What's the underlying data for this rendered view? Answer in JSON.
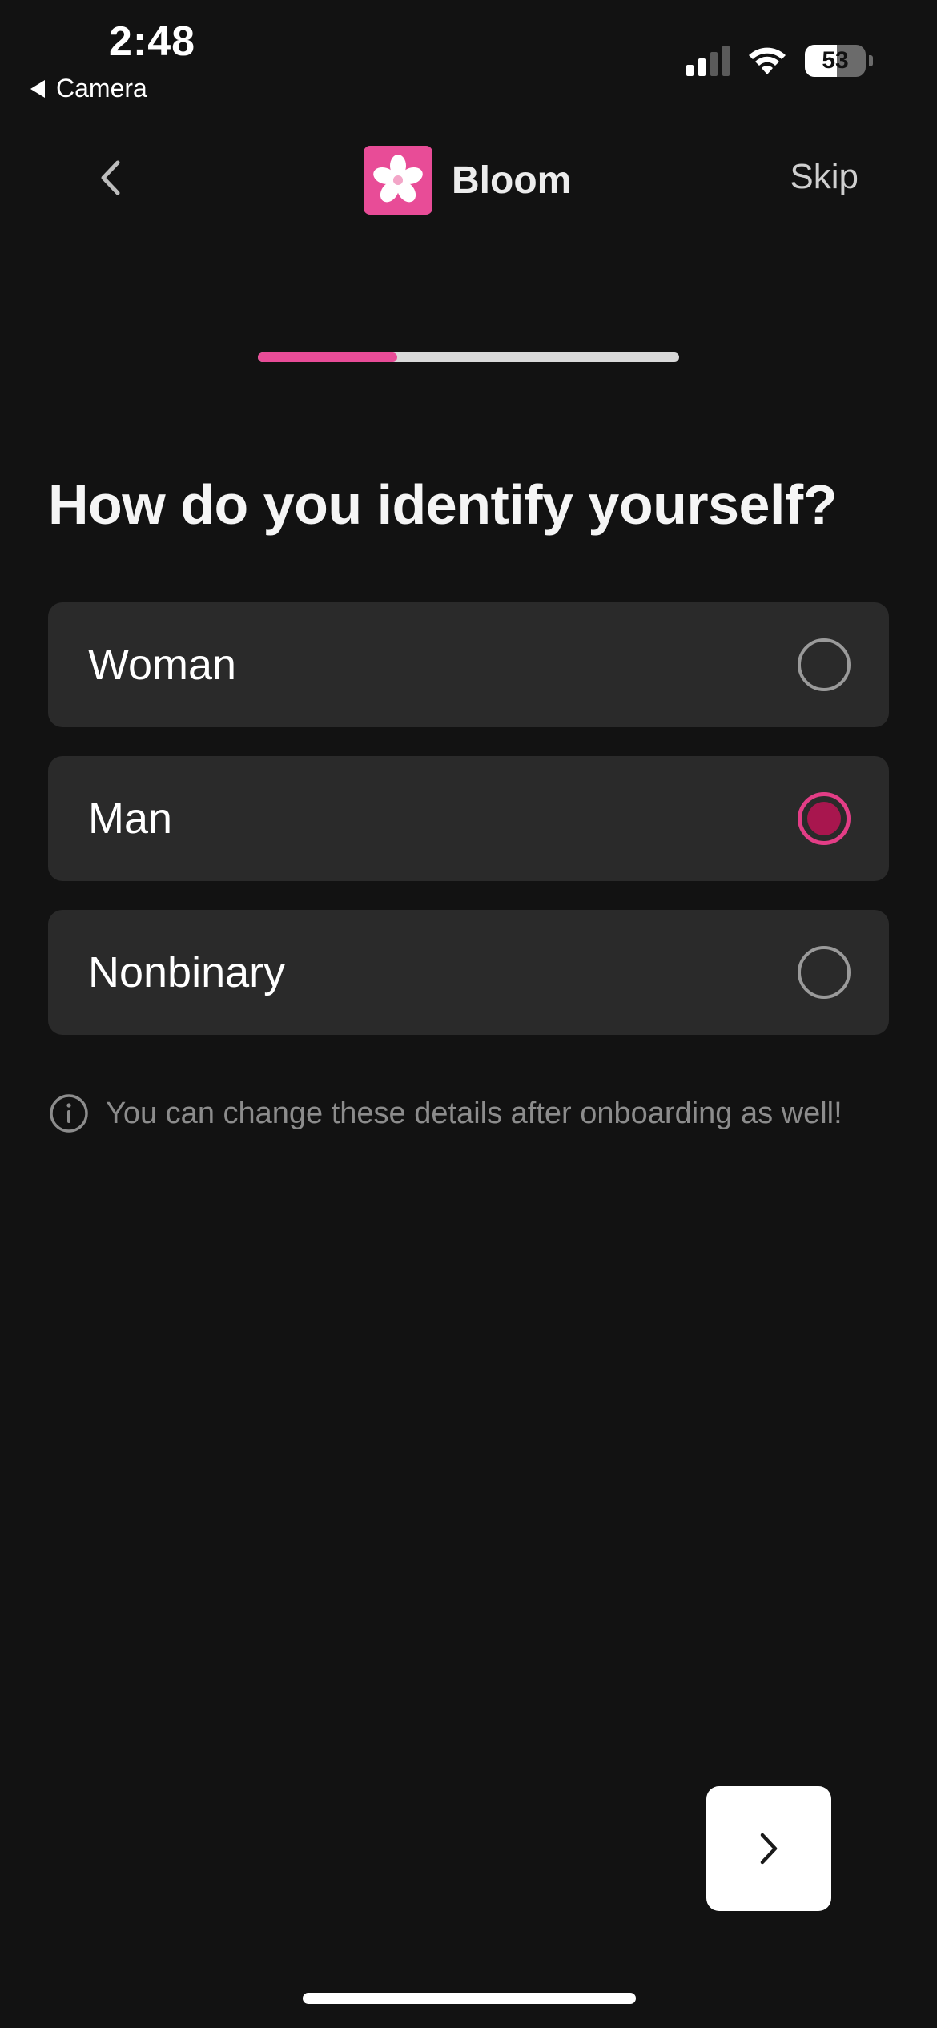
{
  "status_bar": {
    "time": "2:48",
    "back_app_label": "Camera",
    "battery_level": "53",
    "battery_fraction": 0.53,
    "signal_bars_active": 2,
    "signal_bars_total": 4
  },
  "header": {
    "brand_name": "Bloom",
    "skip_label": "Skip",
    "back_icon": "chevron-left-icon",
    "logo_icon": "flower-icon"
  },
  "progress": {
    "fraction": 0.33
  },
  "question": {
    "title": "How do you identify yourself?",
    "options": [
      {
        "label": "Woman",
        "selected": false
      },
      {
        "label": "Man",
        "selected": true
      },
      {
        "label": "Nonbinary",
        "selected": false
      }
    ]
  },
  "info": {
    "icon": "info-icon",
    "text": "You can change these details after onboarding as well!"
  },
  "next_button": {
    "icon": "chevron-right-icon"
  },
  "colors": {
    "background": "#121212",
    "accent": "#e84c97",
    "radio_selected_fill": "#a8164e",
    "option_bg": "#2a2a2a"
  }
}
